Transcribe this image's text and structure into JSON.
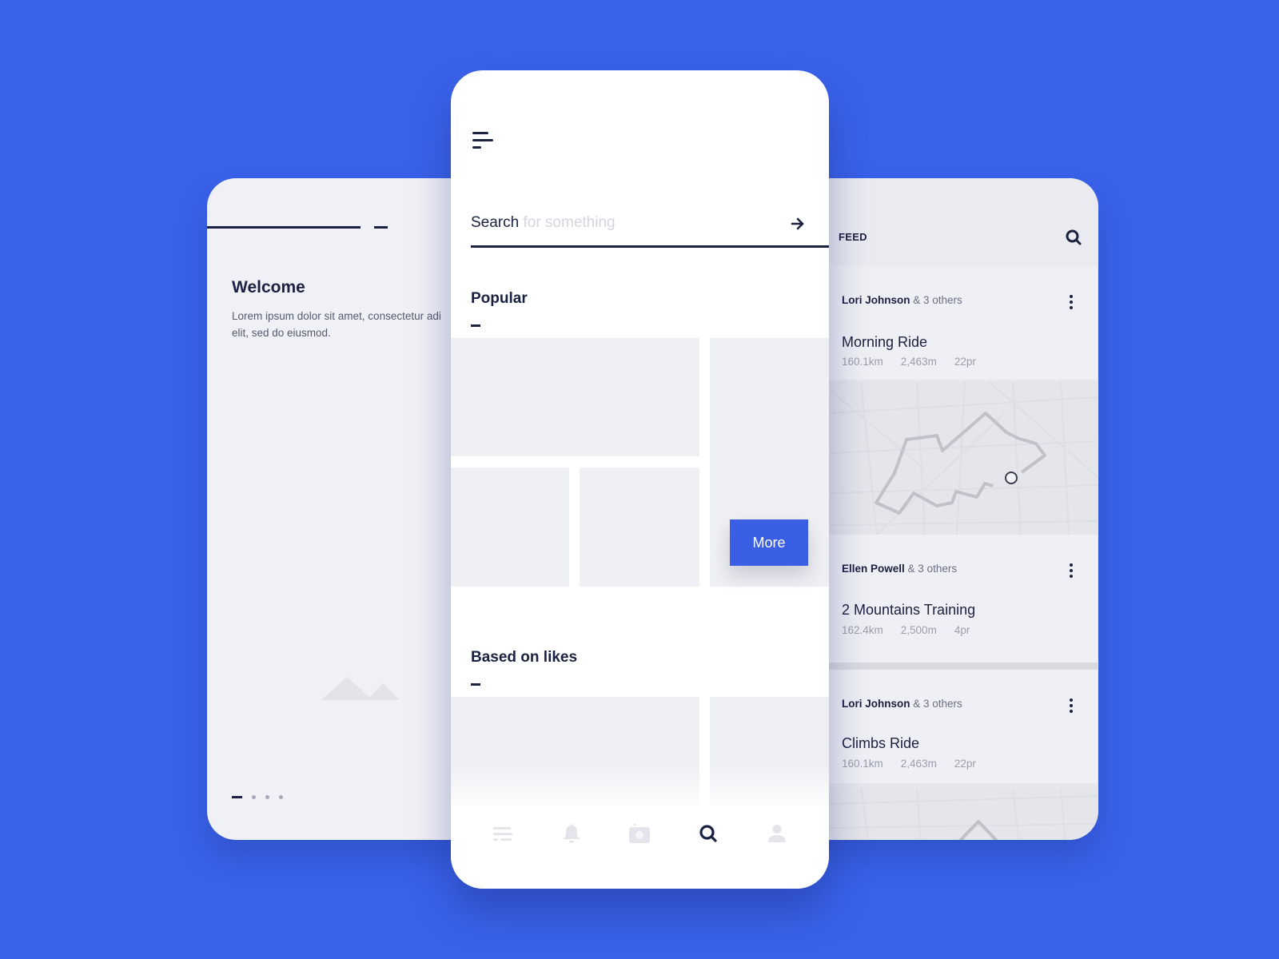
{
  "colors": {
    "background": "#3a62ea",
    "accent": "#3a5fe4",
    "text_dark": "#1b2140",
    "muted": "#9a9eab",
    "placeholder": "#eff0f4"
  },
  "welcome_card": {
    "title": "Welcome",
    "body_line_1": "Lorem ipsum dolor sit amet, consectetur adi",
    "body_line_2": "elit, sed do eiusmod.",
    "image_icon": "mountain-placeholder-icon",
    "pager": {
      "total": 4,
      "active": 1
    }
  },
  "search_screen": {
    "menu_icon": "menu-icon",
    "search": {
      "value": "Search",
      "placeholder": "for something",
      "submit_icon": "arrow-right-icon"
    },
    "sections": [
      {
        "title": "Popular"
      },
      {
        "title": "Based on likes"
      }
    ],
    "more_button": "More",
    "tabbar": [
      {
        "name": "feed",
        "icon": "list-icon",
        "active": false
      },
      {
        "name": "notifications",
        "icon": "bell-icon",
        "active": false
      },
      {
        "name": "camera",
        "icon": "camera-icon",
        "active": false
      },
      {
        "name": "search",
        "icon": "search-icon",
        "active": true
      },
      {
        "name": "profile",
        "icon": "user-icon",
        "active": false
      }
    ]
  },
  "feed_card": {
    "title": "FEED",
    "search_icon": "search-icon",
    "items": [
      {
        "user": "Lori Johnson",
        "others": "& 3 others",
        "title": "Morning Ride",
        "distance": "160.1km",
        "elevation": "2,463m",
        "prs": "22pr",
        "has_map": true
      },
      {
        "user": "Ellen Powell",
        "others": "& 3 others",
        "title": "2 Mountains Training",
        "distance": "162.4km",
        "elevation": "2,500m",
        "prs": "4pr",
        "has_map": false
      },
      {
        "user": "Lori Johnson",
        "others": "& 3 others",
        "title": "Climbs Ride",
        "distance": "160.1km",
        "elevation": "2,463m",
        "prs": "22pr",
        "has_map": true
      }
    ]
  }
}
